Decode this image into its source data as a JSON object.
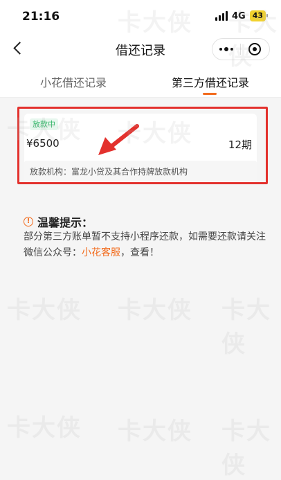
{
  "status_bar": {
    "time": "21:16",
    "network": "4G",
    "battery": "43"
  },
  "nav": {
    "title": "借还记录"
  },
  "tabs": [
    {
      "label": "小花借还记录",
      "active": false
    },
    {
      "label": "第三方借还记录",
      "active": true
    }
  ],
  "record": {
    "status": "放款中",
    "amount": "¥6500",
    "term": "12期",
    "institution": "放款机构：富龙小贷及其合作持牌放款机构"
  },
  "tips": {
    "title": "温馨提示：",
    "text_before": "部分第三方账单暂不支持小程序还款，如需要还款请关注微信公众号：",
    "link": "小花客服",
    "text_after": "，查看！"
  },
  "watermark": "卡大侠",
  "colors": {
    "accent": "#f26b1d",
    "highlight": "#e3312d",
    "status_green": "#34b86a"
  }
}
